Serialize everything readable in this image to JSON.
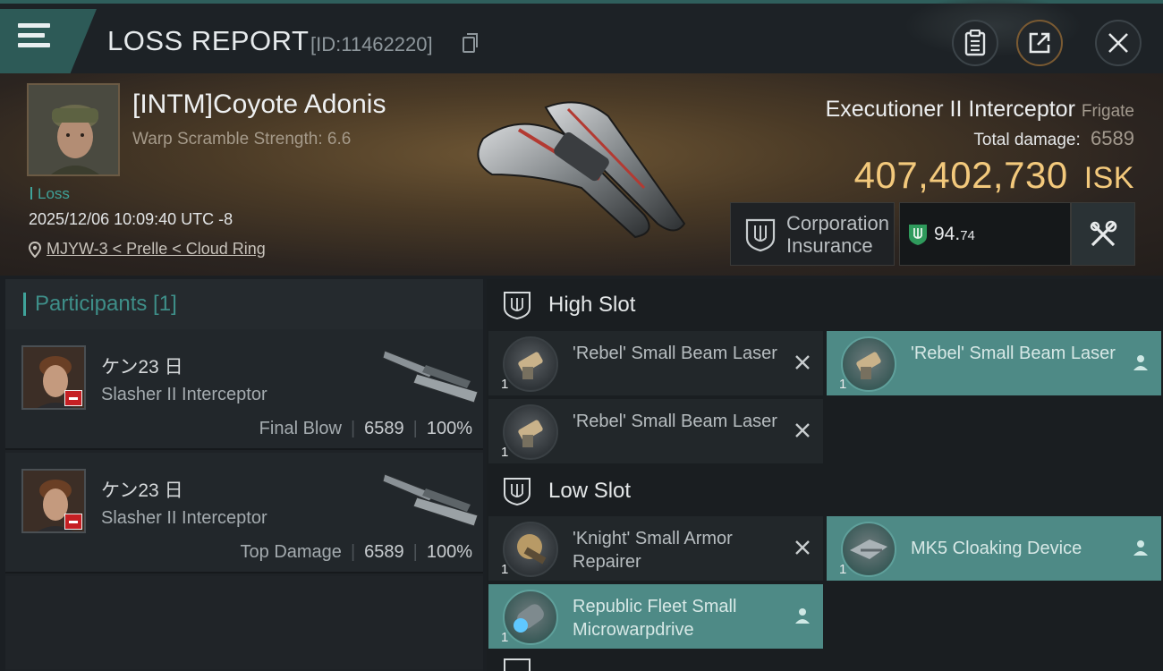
{
  "header": {
    "title": "LOSS REPORT",
    "report_id": "[ID:11462220]"
  },
  "victim": {
    "name": "[INTM]Coyote Adonis",
    "warp_scramble": "Warp Scramble Strength: 6.6",
    "status": "Loss",
    "timestamp": "2025/12/06 10:09:40 UTC -8",
    "location": "MJYW-3 < Prelle < Cloud Ring"
  },
  "ship": {
    "name": "Executioner II Interceptor",
    "class": "Frigate",
    "total_damage_label": "Total damage:",
    "total_damage": "6589",
    "value": "407,402,730",
    "currency": "ISK"
  },
  "insurance": {
    "label_line1": "Corporation",
    "label_line2": "Insurance",
    "value_main": "94.",
    "value_decimal": "74"
  },
  "participants": {
    "title": "Participants [1]",
    "rows": [
      {
        "name": "ケン23 日",
        "ship": "Slasher II Interceptor",
        "role": "Final Blow",
        "damage": "6589",
        "percent": "100%"
      },
      {
        "name": "ケン23 日",
        "ship": "Slasher II Interceptor",
        "role": "Top Damage",
        "damage": "6589",
        "percent": "100%"
      }
    ]
  },
  "slots": {
    "high": {
      "title": "High Slot",
      "modules": [
        {
          "name": "'Rebel' Small Beam Laser",
          "qty": "1",
          "state": "destroyed-x-icon"
        },
        {
          "name": "'Rebel' Small Beam Laser",
          "qty": "1",
          "state": "dropped-person-icon"
        },
        {
          "name": "'Rebel' Small Beam Laser",
          "qty": "1",
          "state": "destroyed-x-icon"
        }
      ]
    },
    "low": {
      "title": "Low Slot",
      "modules": [
        {
          "name": "'Knight' Small Armor Repairer",
          "qty": "1",
          "state": "destroyed-x-icon"
        },
        {
          "name": "MK5 Cloaking Device",
          "qty": "1",
          "state": "dropped-person-icon"
        },
        {
          "name": "Republic Fleet Small Microwarpdrive",
          "qty": "1",
          "state": "dropped-person-icon"
        }
      ]
    }
  },
  "colors": {
    "accent_teal": "#3fa39a",
    "isk_gold": "#f3c97c",
    "dropped_bg": "#4e8a86",
    "destroyed_bg": "#22272a"
  }
}
